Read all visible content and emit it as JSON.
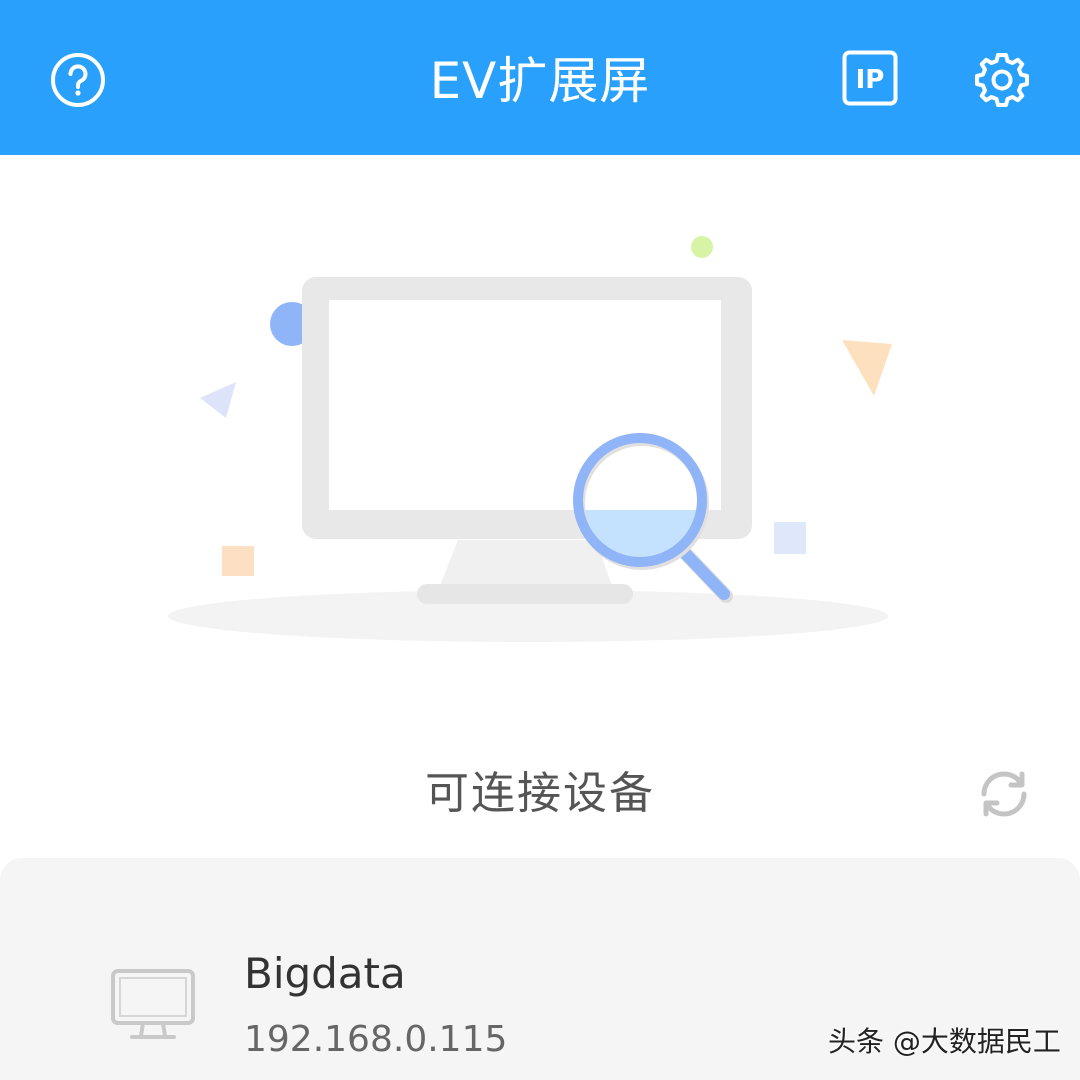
{
  "header": {
    "title": "EV扩展屏",
    "help_icon": "help-circle-icon",
    "ip_icon": "ip-icon",
    "ip_icon_text": "IP",
    "settings_icon": "gear-icon",
    "background_color": "#29a0fb"
  },
  "illustration": {
    "icon": "monitor-search-illustration"
  },
  "devices_section": {
    "title": "可连接设备",
    "refresh_icon": "refresh-icon"
  },
  "devices": [
    {
      "name": "Bigdata",
      "ip": "192.168.0.115",
      "icon": "monitor-icon"
    }
  ],
  "watermark": {
    "text": "头条 @大数据民工"
  }
}
